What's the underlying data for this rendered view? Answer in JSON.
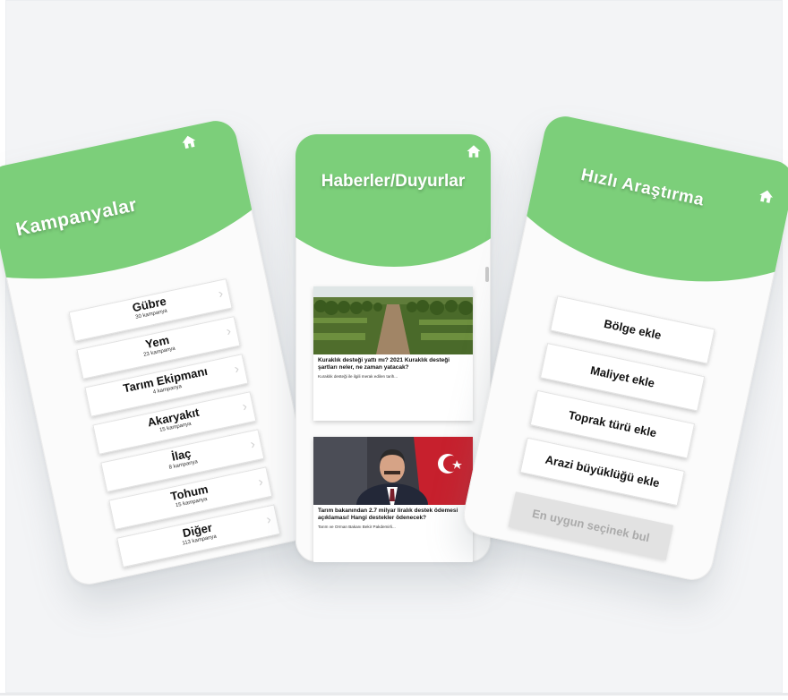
{
  "colors": {
    "accent": "#7ccf7a",
    "background": "#f3f4f6",
    "card": "#ffffff"
  },
  "icons": {
    "home": "home-icon",
    "chevron": "chevron-right-icon"
  },
  "screens": {
    "kampanyalar": {
      "title": "Kampanyalar",
      "categories": [
        {
          "name": "Gübre",
          "count": "30 kampanya"
        },
        {
          "name": "Yem",
          "count": "23 kampanya"
        },
        {
          "name": "Tarım Ekipmanı",
          "count": "4 kampanya"
        },
        {
          "name": "Akaryakıt",
          "count": "15 kampanya"
        },
        {
          "name": "İlaç",
          "count": "8 kampanya"
        },
        {
          "name": "Tohum",
          "count": "15 kampanya"
        },
        {
          "name": "Diğer",
          "count": "113 kampanya"
        }
      ]
    },
    "haberler": {
      "title": "Haberler/Duyurlar",
      "news": [
        {
          "headline": "Kuraklık desteği yattı mı? 2021 Kuraklık desteği şartları neler, ne zaman yatacak?",
          "body": "Kuraklık desteği ile ilgili merak edilen tarih..."
        },
        {
          "headline": "Tarım bakanından 2.7 milyar liralık destek ödemesi açıklaması! Hangi destekler ödenecek?",
          "body": "Tarım ve Orman Bakanı Bekir Pakdemirli..."
        }
      ]
    },
    "hizli_arastirma": {
      "title": "Hızlı Araştırma",
      "actions": [
        "Bölge ekle",
        "Maliyet ekle",
        "Toprak türü ekle",
        "Arazi büyüklüğü ekle"
      ],
      "find_button": "En uygun seçinek bul"
    }
  }
}
